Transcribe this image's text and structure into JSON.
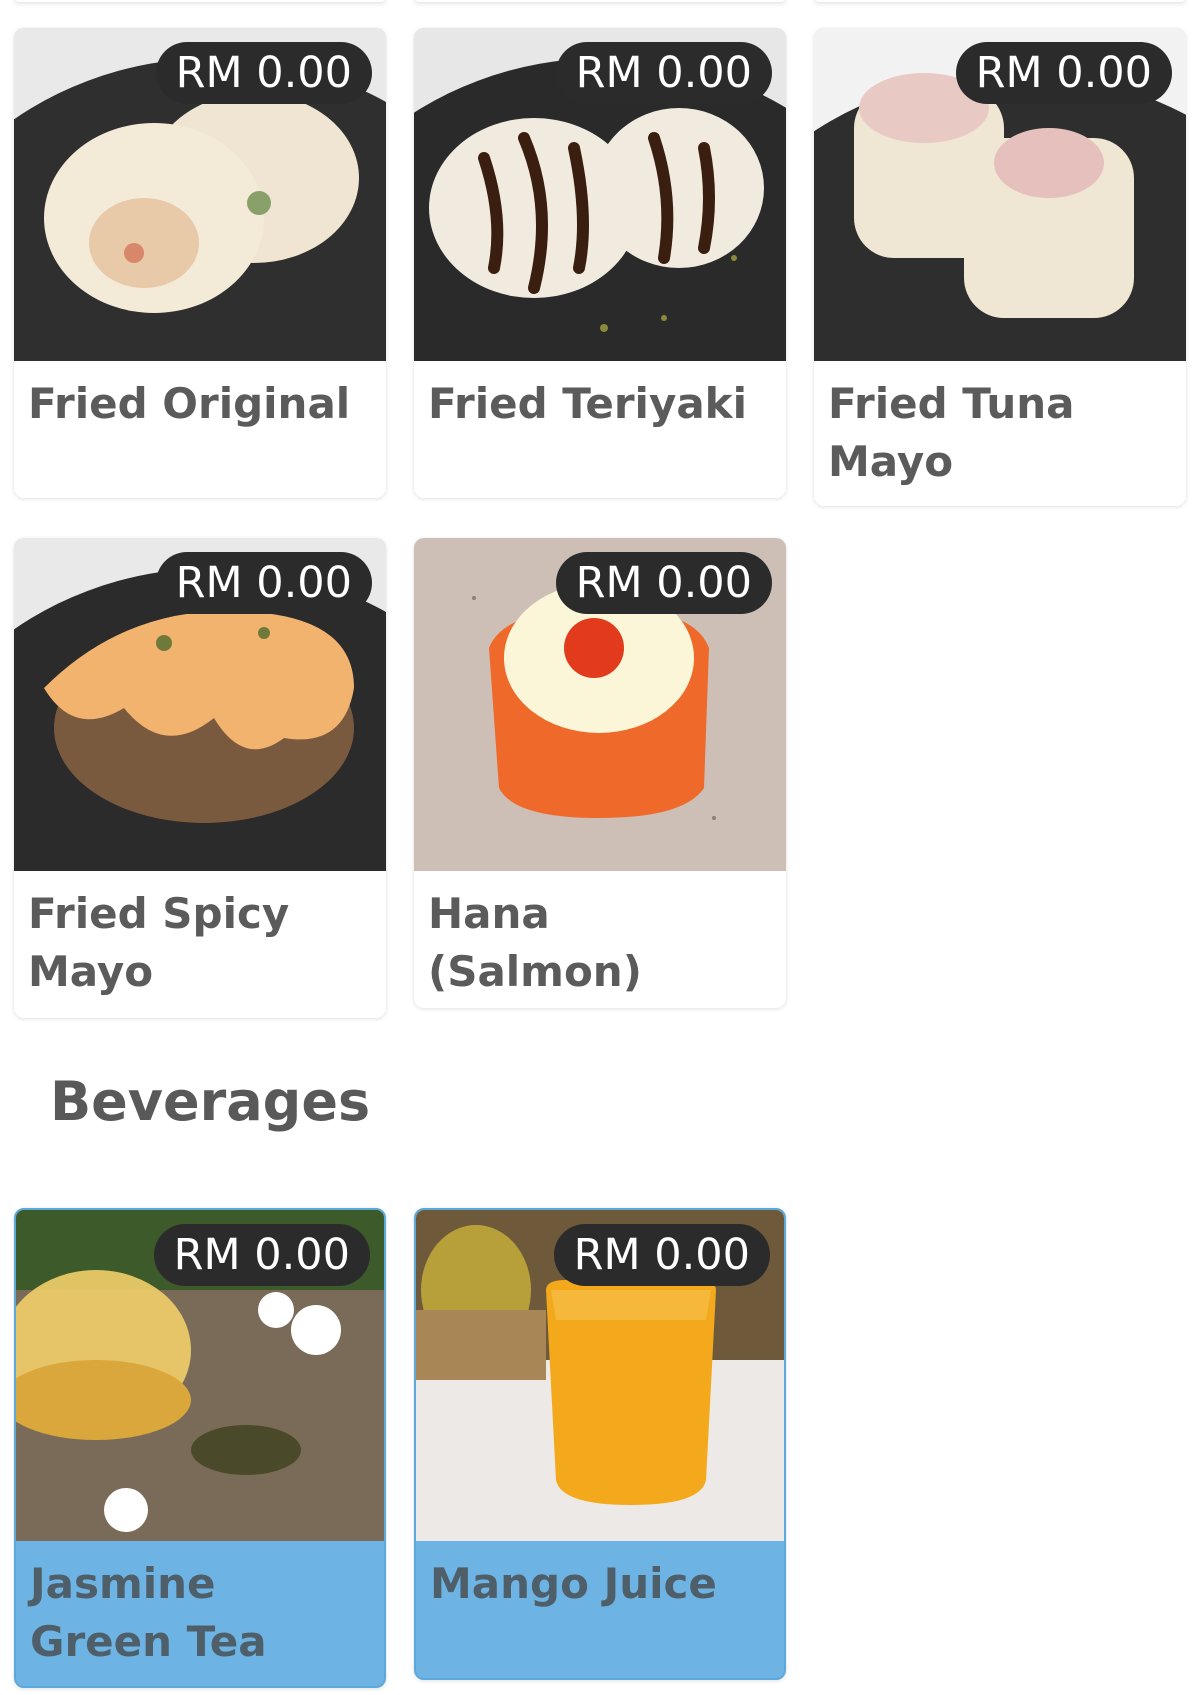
{
  "menu": {
    "sushi_items": [
      {
        "name": "Fried Original",
        "price": "RM 0.00",
        "photo_icon": "fried-sushi-photo"
      },
      {
        "name": "Fried Teriyaki",
        "price": "RM 0.00",
        "photo_icon": "teriyaki-sushi-photo"
      },
      {
        "name": "Fried Tuna Mayo",
        "price": "RM 0.00",
        "photo_icon": "tuna-mayo-sushi-photo"
      },
      {
        "name": "Fried Spicy Mayo",
        "price": "RM 0.00",
        "photo_icon": "spicy-mayo-sushi-photo"
      },
      {
        "name": "Hana (Salmon)",
        "price": "RM 0.00",
        "photo_icon": "salmon-sushi-photo"
      }
    ],
    "beverages_title": "Beverages",
    "beverage_items": [
      {
        "name": "Jasmine Green Tea",
        "price": "RM 0.00",
        "photo_icon": "jasmine-tea-photo"
      },
      {
        "name": "Mango Juice",
        "price": "RM 0.00",
        "photo_icon": "mango-juice-photo"
      }
    ]
  },
  "colors": {
    "price_badge_bg": "#2b2b2b",
    "selected_card_bg": "#6db4e4",
    "text_gray": "#5b5b5b"
  }
}
